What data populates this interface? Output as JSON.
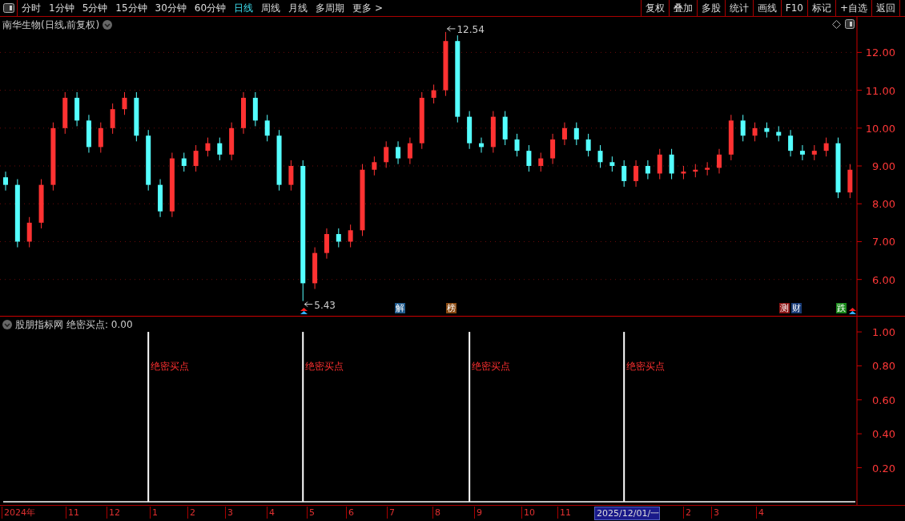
{
  "toolbar": {
    "periods": [
      {
        "label": "分时",
        "selected": false
      },
      {
        "label": "1分钟",
        "selected": false
      },
      {
        "label": "5分钟",
        "selected": false
      },
      {
        "label": "15分钟",
        "selected": false
      },
      {
        "label": "30分钟",
        "selected": false
      },
      {
        "label": "60分钟",
        "selected": false
      },
      {
        "label": "日线",
        "selected": true
      },
      {
        "label": "周线",
        "selected": false
      },
      {
        "label": "月线",
        "selected": false
      },
      {
        "label": "多周期",
        "selected": false
      }
    ],
    "more": "更多 >",
    "buttons": [
      "复权",
      "叠加",
      "多股",
      "统计",
      "画线",
      "F10",
      "标记",
      "+自选",
      "返回"
    ]
  },
  "price_panel": {
    "title": "南华生物(日线,前复权)",
    "markers": [
      {
        "text": "解",
        "color": "#1f5a8c"
      },
      {
        "text": "榜",
        "color": "#8a4a12"
      },
      {
        "text": "测",
        "color": "#8c1414"
      },
      {
        "text": "财",
        "color": "#1a3d78"
      },
      {
        "text": "跌",
        "color": "#1a8a1a"
      }
    ],
    "chart_data": {
      "type": "candlestick",
      "grid": true,
      "ylim": [
        5.04,
        12.94
      ],
      "yticks": [
        {
          "value": 6,
          "label": "6.00"
        },
        {
          "value": 7,
          "label": "7.00"
        },
        {
          "value": 8,
          "label": "8.00"
        },
        {
          "value": 9,
          "label": "9.00"
        },
        {
          "value": 10,
          "label": "10.00"
        },
        {
          "value": 11,
          "label": "11.00"
        },
        {
          "value": 12,
          "label": "12.00"
        }
      ],
      "categories": [
        null,
        null,
        null,
        null,
        null,
        null,
        null,
        null,
        null,
        null,
        null,
        null,
        null,
        null,
        null,
        null,
        null,
        null,
        null,
        null,
        null,
        null,
        null,
        null,
        null,
        null,
        null,
        null,
        null,
        null,
        null,
        null,
        null,
        null,
        null,
        null,
        null,
        null,
        null,
        null,
        null,
        null,
        null,
        null,
        null,
        null,
        null,
        null,
        null,
        null,
        null,
        null,
        null,
        null,
        null,
        null,
        null,
        null,
        null,
        null,
        null,
        null,
        null,
        null,
        null,
        null,
        null,
        null,
        null,
        null,
        null,
        null
      ],
      "ohlc": [
        [
          8.7,
          8.85,
          8.35,
          8.5
        ],
        [
          8.5,
          8.65,
          6.85,
          7.0
        ],
        [
          7.0,
          7.65,
          6.85,
          7.5
        ],
        [
          7.5,
          8.65,
          7.35,
          8.5
        ],
        [
          8.5,
          10.15,
          8.35,
          10.0
        ],
        [
          10.0,
          10.95,
          9.85,
          10.8
        ],
        [
          10.8,
          10.95,
          10.05,
          10.2
        ],
        [
          10.2,
          10.35,
          9.35,
          9.5
        ],
        [
          9.5,
          10.15,
          9.35,
          10.0
        ],
        [
          10.0,
          10.65,
          9.85,
          10.5
        ],
        [
          10.5,
          10.95,
          10.35,
          10.8
        ],
        [
          10.8,
          10.95,
          9.65,
          9.8
        ],
        [
          9.8,
          9.95,
          8.35,
          8.5
        ],
        [
          8.5,
          8.65,
          7.65,
          7.8
        ],
        [
          7.8,
          9.35,
          7.65,
          9.2
        ],
        [
          9.2,
          9.35,
          8.85,
          9.0
        ],
        [
          9.0,
          9.55,
          8.85,
          9.4
        ],
        [
          9.4,
          9.75,
          9.25,
          9.6
        ],
        [
          9.6,
          9.75,
          9.15,
          9.3
        ],
        [
          9.3,
          10.15,
          9.15,
          10.0
        ],
        [
          10.0,
          10.95,
          9.85,
          10.8
        ],
        [
          10.8,
          10.95,
          10.05,
          10.2
        ],
        [
          10.2,
          10.35,
          9.65,
          9.8
        ],
        [
          9.8,
          9.95,
          8.35,
          8.5
        ],
        [
          8.5,
          9.15,
          8.35,
          9.0
        ],
        [
          9.0,
          9.15,
          5.43,
          5.9
        ],
        [
          5.9,
          6.85,
          5.75,
          6.7
        ],
        [
          6.7,
          7.35,
          6.55,
          7.2
        ],
        [
          7.2,
          7.35,
          6.85,
          7.0
        ],
        [
          7.0,
          7.45,
          6.85,
          7.3
        ],
        [
          7.3,
          9.05,
          7.15,
          8.9
        ],
        [
          8.9,
          9.25,
          8.75,
          9.1
        ],
        [
          9.1,
          9.65,
          8.95,
          9.5
        ],
        [
          9.5,
          9.65,
          9.05,
          9.2
        ],
        [
          9.2,
          9.75,
          9.05,
          9.6
        ],
        [
          9.6,
          10.95,
          9.45,
          10.8
        ],
        [
          10.8,
          11.15,
          10.65,
          11.0
        ],
        [
          11.0,
          12.54,
          10.85,
          12.3
        ],
        [
          12.3,
          12.45,
          10.15,
          10.3
        ],
        [
          10.3,
          10.45,
          9.45,
          9.6
        ],
        [
          9.6,
          9.75,
          9.35,
          9.5
        ],
        [
          9.5,
          10.45,
          9.35,
          10.3
        ],
        [
          10.3,
          10.45,
          9.55,
          9.7
        ],
        [
          9.7,
          9.85,
          9.25,
          9.4
        ],
        [
          9.4,
          9.55,
          8.85,
          9.0
        ],
        [
          9.0,
          9.35,
          8.85,
          9.2
        ],
        [
          9.2,
          9.85,
          9.05,
          9.7
        ],
        [
          9.7,
          10.15,
          9.55,
          10.0
        ],
        [
          10.0,
          10.15,
          9.55,
          9.7
        ],
        [
          9.7,
          9.85,
          9.25,
          9.4
        ],
        [
          9.4,
          9.55,
          8.95,
          9.1
        ],
        [
          9.1,
          9.25,
          8.85,
          9.0
        ],
        [
          9.0,
          9.15,
          8.45,
          8.6
        ],
        [
          8.6,
          9.15,
          8.45,
          9.0
        ],
        [
          9.0,
          9.15,
          8.65,
          8.8
        ],
        [
          8.8,
          9.45,
          8.65,
          9.3
        ],
        [
          9.3,
          9.45,
          8.65,
          8.8
        ],
        [
          8.8,
          9.0,
          8.65,
          8.85
        ],
        [
          8.85,
          9.05,
          8.7,
          8.9
        ],
        [
          8.9,
          9.1,
          8.75,
          8.95
        ],
        [
          8.95,
          9.45,
          8.8,
          9.3
        ],
        [
          9.3,
          10.35,
          9.15,
          10.2
        ],
        [
          10.2,
          10.35,
          9.65,
          9.8
        ],
        [
          9.8,
          10.15,
          9.65,
          10.0
        ],
        [
          10.0,
          10.15,
          9.75,
          9.9
        ],
        [
          9.9,
          10.05,
          9.65,
          9.8
        ],
        [
          9.8,
          9.95,
          9.25,
          9.4
        ],
        [
          9.4,
          9.55,
          9.15,
          9.3
        ],
        [
          9.3,
          9.55,
          9.15,
          9.4
        ],
        [
          9.4,
          9.75,
          9.25,
          9.6
        ],
        [
          9.6,
          9.75,
          8.15,
          8.3
        ],
        [
          8.3,
          9.05,
          8.15,
          8.9
        ]
      ],
      "annotations": [
        "12.54",
        "5.43"
      ]
    }
  },
  "indicator_panel": {
    "title": "股朋指标网",
    "reading": "绝密买点: 0.00",
    "chart_data": {
      "type": "bar",
      "ylim": [
        -0.024,
        1.09
      ],
      "yticks": [
        {
          "value": 0.2,
          "label": "0.20"
        },
        {
          "value": 0.4,
          "label": "0.40"
        },
        {
          "value": 0.6,
          "label": "0.60"
        },
        {
          "value": 0.8,
          "label": "0.80"
        },
        {
          "value": 1,
          "label": "1.00"
        }
      ],
      "categories": [
        null,
        null,
        null,
        null,
        null,
        null,
        null,
        null,
        null,
        null,
        null,
        null,
        null,
        null,
        null,
        null,
        null,
        null,
        null,
        null,
        null,
        null,
        null,
        null,
        null,
        null,
        null,
        null,
        null,
        null,
        null,
        null,
        null,
        null,
        null,
        null,
        null,
        null,
        null,
        null,
        null,
        null,
        null,
        null,
        null,
        null,
        null,
        null,
        null,
        null,
        null,
        null,
        null,
        null,
        null,
        null,
        null,
        null,
        null,
        null,
        null,
        null,
        null,
        null,
        null,
        null,
        null,
        null,
        null,
        null,
        null,
        null
      ],
      "values": [
        0,
        0,
        0,
        0,
        0,
        0,
        0,
        0,
        0,
        0,
        0,
        0,
        1,
        0,
        0,
        0,
        0,
        0,
        0,
        0,
        0,
        0,
        0,
        0,
        0,
        1,
        0,
        0,
        0,
        0,
        0,
        0,
        0,
        0,
        0,
        0,
        0,
        0,
        0,
        1,
        0,
        0,
        0,
        0,
        0,
        0,
        0,
        0,
        0,
        0,
        0,
        0,
        1,
        0,
        0,
        0,
        0,
        0,
        0,
        0,
        0,
        0,
        0,
        0,
        0,
        0,
        0,
        0,
        0,
        0,
        0,
        0
      ],
      "annotations": [
        "绝密买点",
        "绝密买点",
        "绝密买点",
        "绝密买点"
      ]
    }
  },
  "time_axis": [
    {
      "label": "2024年",
      "selected": false
    },
    {
      "label": "11",
      "selected": false
    },
    {
      "label": "12",
      "selected": false
    },
    {
      "label": "1",
      "selected": false
    },
    {
      "label": "2",
      "selected": false
    },
    {
      "label": "3",
      "selected": false
    },
    {
      "label": "4",
      "selected": false
    },
    {
      "label": "5",
      "selected": false
    },
    {
      "label": "6",
      "selected": false
    },
    {
      "label": "7",
      "selected": false
    },
    {
      "label": "8",
      "selected": false
    },
    {
      "label": "9",
      "selected": false
    },
    {
      "label": "10",
      "selected": false
    },
    {
      "label": "11",
      "selected": false
    },
    {
      "label": "2025/12/01/一",
      "selected": true
    },
    {
      "label": "2",
      "selected": false
    },
    {
      "label": "3",
      "selected": false
    },
    {
      "label": "4",
      "selected": false
    }
  ]
}
